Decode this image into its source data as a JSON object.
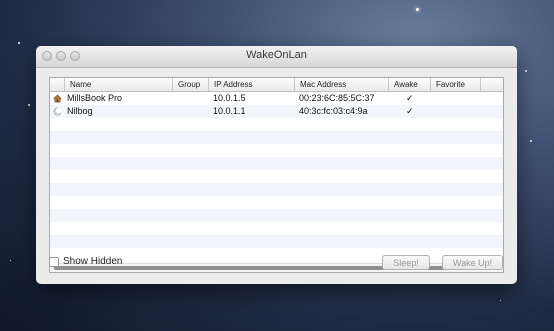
{
  "window": {
    "title": "WakeOnLan"
  },
  "table": {
    "columns": [
      "Name",
      "Group",
      "IP Address",
      "Mac Address",
      "Awake",
      "Favorite"
    ],
    "rows": [
      {
        "icon": "house-icon",
        "name": "MillsBook Pro",
        "group": "",
        "ip": "10.0.1.5",
        "mac": "00:23:6C:85:5C:37",
        "awake": "✓",
        "favorite": ""
      },
      {
        "icon": "moon-icon",
        "name": "Nilbog",
        "group": "",
        "ip": "10.0.1.1",
        "mac": "40:3c:fc:03:c4:9a",
        "awake": "✓",
        "favorite": ""
      }
    ]
  },
  "footer": {
    "show_hidden_label": "Show Hidden",
    "sleep_label": "Sleep!",
    "wake_label": "Wake Up!"
  }
}
